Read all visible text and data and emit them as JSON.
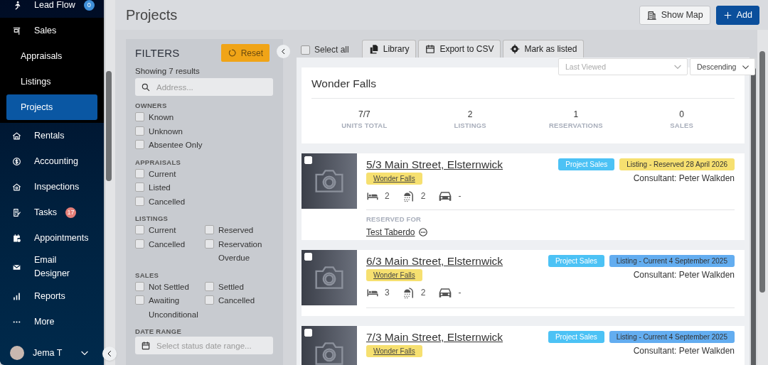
{
  "sidebar": {
    "items": [
      {
        "label": "Lead Flow",
        "selected": false,
        "badge": {
          "text": "0",
          "color": "#3f8fd8"
        }
      },
      {
        "label": "Sales",
        "selected": false,
        "children": [
          {
            "label": "Appraisals",
            "selected": false
          },
          {
            "label": "Listings",
            "selected": false
          },
          {
            "label": "Projects",
            "selected": true
          }
        ]
      },
      {
        "label": "Rentals",
        "selected": false
      },
      {
        "label": "Accounting",
        "selected": false
      },
      {
        "label": "Inspections",
        "selected": false
      },
      {
        "label": "Tasks",
        "selected": false,
        "badge": {
          "text": "17",
          "color": "#e57f78"
        }
      },
      {
        "label": "Appointments",
        "selected": false
      },
      {
        "label": "Email Designer",
        "selected": false
      },
      {
        "label": "Reports",
        "selected": false
      },
      {
        "label": "More",
        "selected": false
      }
    ],
    "user": {
      "name": "Jema T"
    }
  },
  "header": {
    "title": "Projects",
    "buttons": [
      {
        "label": "Show Map",
        "kind": "secondary"
      },
      {
        "label": "Add",
        "kind": "primary"
      }
    ]
  },
  "filters": {
    "title": "FILTERS",
    "reset": "Reset",
    "summary": "Showing 7 results",
    "search": {
      "placeholder": "Address..."
    },
    "sections": [
      {
        "title": "OWNERS",
        "kind": "list",
        "options": [
          {
            "label": "Known",
            "checked": false
          },
          {
            "label": "Unknown",
            "checked": false
          },
          {
            "label": "Absentee Only",
            "checked": false
          }
        ]
      },
      {
        "title": "APPRAISALS",
        "kind": "list",
        "options": [
          {
            "label": "Current",
            "checked": false
          },
          {
            "label": "Listed",
            "checked": false
          },
          {
            "label": "Cancelled",
            "checked": false
          }
        ]
      },
      {
        "title": "LISTINGS",
        "kind": "grid",
        "options": [
          {
            "label": "Current",
            "checked": false
          },
          {
            "label": "Reserved",
            "checked": false
          },
          {
            "label": "Cancelled",
            "checked": false
          },
          {
            "label": "Reservation Overdue",
            "checked": false
          }
        ]
      },
      {
        "title": "SALES",
        "kind": "grid",
        "options": [
          {
            "label": "Not Settled",
            "checked": false
          },
          {
            "label": "Settled",
            "checked": false
          },
          {
            "label": "Awaiting Unconditional",
            "checked": false
          },
          {
            "label": "Cancelled",
            "checked": false
          }
        ]
      }
    ],
    "date_range": {
      "title": "DATE RANGE",
      "placeholder": "Select status date range..."
    }
  },
  "results": {
    "select_all": {
      "label": "Select all",
      "checked": false
    },
    "actions": [
      "Library",
      "Export to CSV",
      "Mark as listed"
    ],
    "sort": {
      "field": {
        "placeholder": "Last Viewed"
      },
      "order": {
        "value": "Descending"
      }
    },
    "project": {
      "title": "Wonder Falls",
      "stats": [
        {
          "value": "7/7",
          "label": "UNITS TOTAL"
        },
        {
          "value": "2",
          "label": "LISTINGS"
        },
        {
          "value": "1",
          "label": "RESERVATIONS"
        },
        {
          "value": "0",
          "label": "SALES"
        }
      ]
    },
    "listings": [
      {
        "checked": false,
        "address": "5/3 Main Street, Elsternwick",
        "project": "Wonder Falls",
        "tags": [
          {
            "label": "Project Sales",
            "kind": "type",
            "color": "#4cc2f5"
          },
          {
            "label": "Listing - Reserved 28 April 2026",
            "kind": "status",
            "color": "#f6e070"
          }
        ],
        "consultant": "Consultant: Peter Walkden",
        "beds": "2",
        "baths": "2",
        "cars": "-",
        "reserved_for": {
          "title": "RESERVED FOR",
          "name": "Test Taberdo"
        }
      },
      {
        "checked": false,
        "address": "6/3 Main Street, Elsternwick",
        "project": "Wonder Falls",
        "tags": [
          {
            "label": "Project Sales",
            "kind": "type",
            "color": "#4cc2f5"
          },
          {
            "label": "Listing - Current 4 September 2025",
            "kind": "status",
            "color": "#63adf0"
          }
        ],
        "consultant": "Consultant: Peter Walkden",
        "beds": "3",
        "baths": "2",
        "cars": "-"
      },
      {
        "checked": false,
        "address": "7/3 Main Street, Elsternwick",
        "project": "Wonder Falls",
        "tags": [
          {
            "label": "Project Sales",
            "kind": "type",
            "color": "#4cc2f5"
          },
          {
            "label": "Listing - Current 4 September 2025",
            "kind": "status",
            "color": "#63adf0"
          }
        ],
        "consultant": "Consultant: Peter Walkden"
      }
    ]
  }
}
